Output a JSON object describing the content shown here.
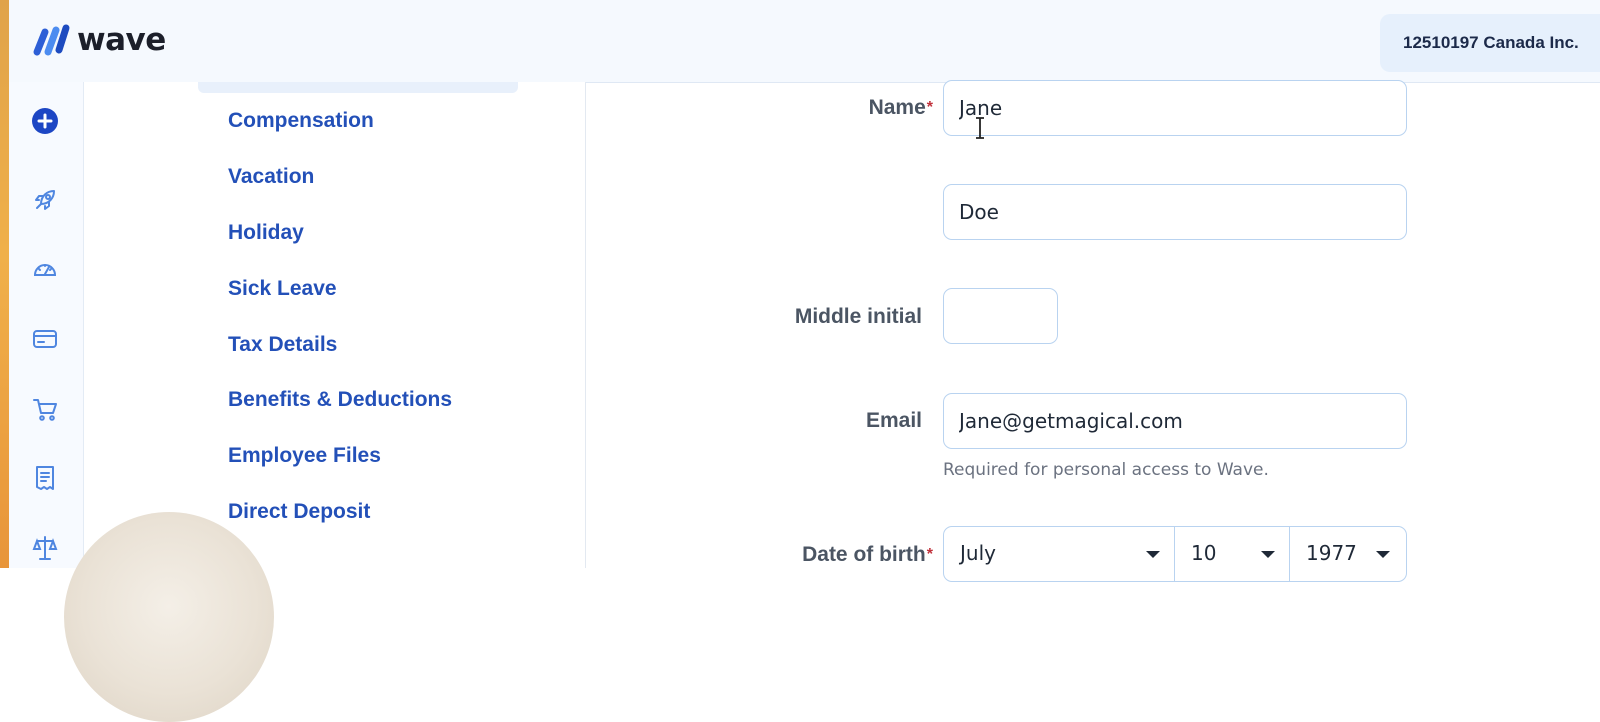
{
  "app": {
    "brand": "wave",
    "business_name": "12510197 Canada Inc."
  },
  "rail_icons": [
    "plus-circle-icon",
    "rocket-icon",
    "dashboard-gauge-icon",
    "credit-card-icon",
    "cart-icon",
    "receipt-icon",
    "scale-icon"
  ],
  "section_nav": {
    "items": [
      {
        "label": "Compensation"
      },
      {
        "label": "Vacation"
      },
      {
        "label": "Holiday"
      },
      {
        "label": "Sick Leave"
      },
      {
        "label": "Tax Details"
      },
      {
        "label": "Benefits & Deductions"
      },
      {
        "label": "Employee Files"
      },
      {
        "label": "Direct Deposit"
      }
    ]
  },
  "form": {
    "name_label": "Name",
    "required_marker": "*",
    "first_name_value": "Jane",
    "last_name_value": "Doe",
    "middle_initial_label": "Middle initial",
    "middle_initial_value": "",
    "email_label": "Email",
    "email_value": "Jane@getmagical.com",
    "email_helper": "Required for personal access to Wave.",
    "dob_label": "Date of birth",
    "dob_month": "July",
    "dob_day": "10",
    "dob_year": "1977"
  },
  "colors": {
    "brand_blue": "#2350b8",
    "required_red": "#c0313b",
    "input_border": "#b9d3f0"
  }
}
